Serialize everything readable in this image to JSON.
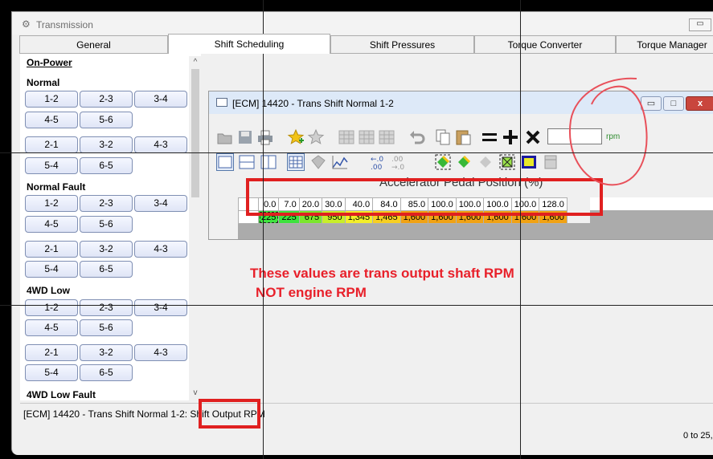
{
  "window": {
    "title": "Transmission",
    "minimize_glyph": "▭",
    "icon": "gear-icon"
  },
  "tabs": [
    "General",
    "Shift Scheduling",
    "Shift Pressures",
    "Torque Converter",
    "Torque Manager"
  ],
  "active_tab": "Shift Scheduling",
  "left_panel": {
    "heading": "On-Power",
    "sections": [
      {
        "title": "Normal",
        "rows": [
          [
            "1-2",
            "2-3",
            "3-4"
          ],
          [
            "4-5",
            "5-6"
          ],
          [
            "2-1",
            "3-2",
            "4-3"
          ],
          [
            "5-4",
            "6-5"
          ]
        ]
      },
      {
        "title": "Normal Fault",
        "rows": [
          [
            "1-2",
            "2-3",
            "3-4"
          ],
          [
            "4-5",
            "5-6"
          ],
          [
            "2-1",
            "3-2",
            "4-3"
          ],
          [
            "5-4",
            "6-5"
          ]
        ]
      },
      {
        "title": "4WD Low",
        "rows": [
          [
            "1-2",
            "2-3",
            "3-4"
          ],
          [
            "4-5",
            "5-6"
          ],
          [
            "2-1",
            "3-2",
            "4-3"
          ],
          [
            "5-4",
            "6-5"
          ]
        ]
      },
      {
        "title": "4WD Low Fault"
      }
    ],
    "scroll_up": "^",
    "scroll_down": "v"
  },
  "ecm_window": {
    "title": "[ECM] 14420 - Trans Shift Normal 1-2",
    "min_glyph": "▭",
    "max_glyph": "□",
    "close_glyph": "x",
    "rpm_value": "",
    "rpm_unit": "rpm",
    "axis_title": "Accelerator Pedal Position (%)",
    "table": {
      "headers": [
        "0.0",
        "7.0",
        "20.0",
        "30.0",
        "40.0",
        "84.0",
        "85.0",
        "100.0",
        "100.0",
        "100.0",
        "100.0",
        "128.0"
      ],
      "values": [
        "225",
        "225",
        "675",
        "950",
        "1,345",
        "1,465",
        "1,600",
        "1,600",
        "1,600",
        "1,600",
        "1,600",
        "1,600"
      ],
      "cell_colors": [
        "#3ee23e",
        "#3ee23e",
        "#7be62e",
        "#c8ee2a",
        "#f3ee2a",
        "#f7cf22",
        "#f0a214",
        "#f0a214",
        "#f0a214",
        "#f0a214",
        "#f0a214",
        "#f0a214"
      ]
    }
  },
  "annotation": {
    "line1": "These values are trans output shaft RPM",
    "line2": "NOT engine RPM",
    "color": "#e8202a"
  },
  "status": {
    "text": "[ECM] 14420 - Trans Shift Normal 1-2: Shift Output RPM",
    "range": "0 to 25,"
  }
}
